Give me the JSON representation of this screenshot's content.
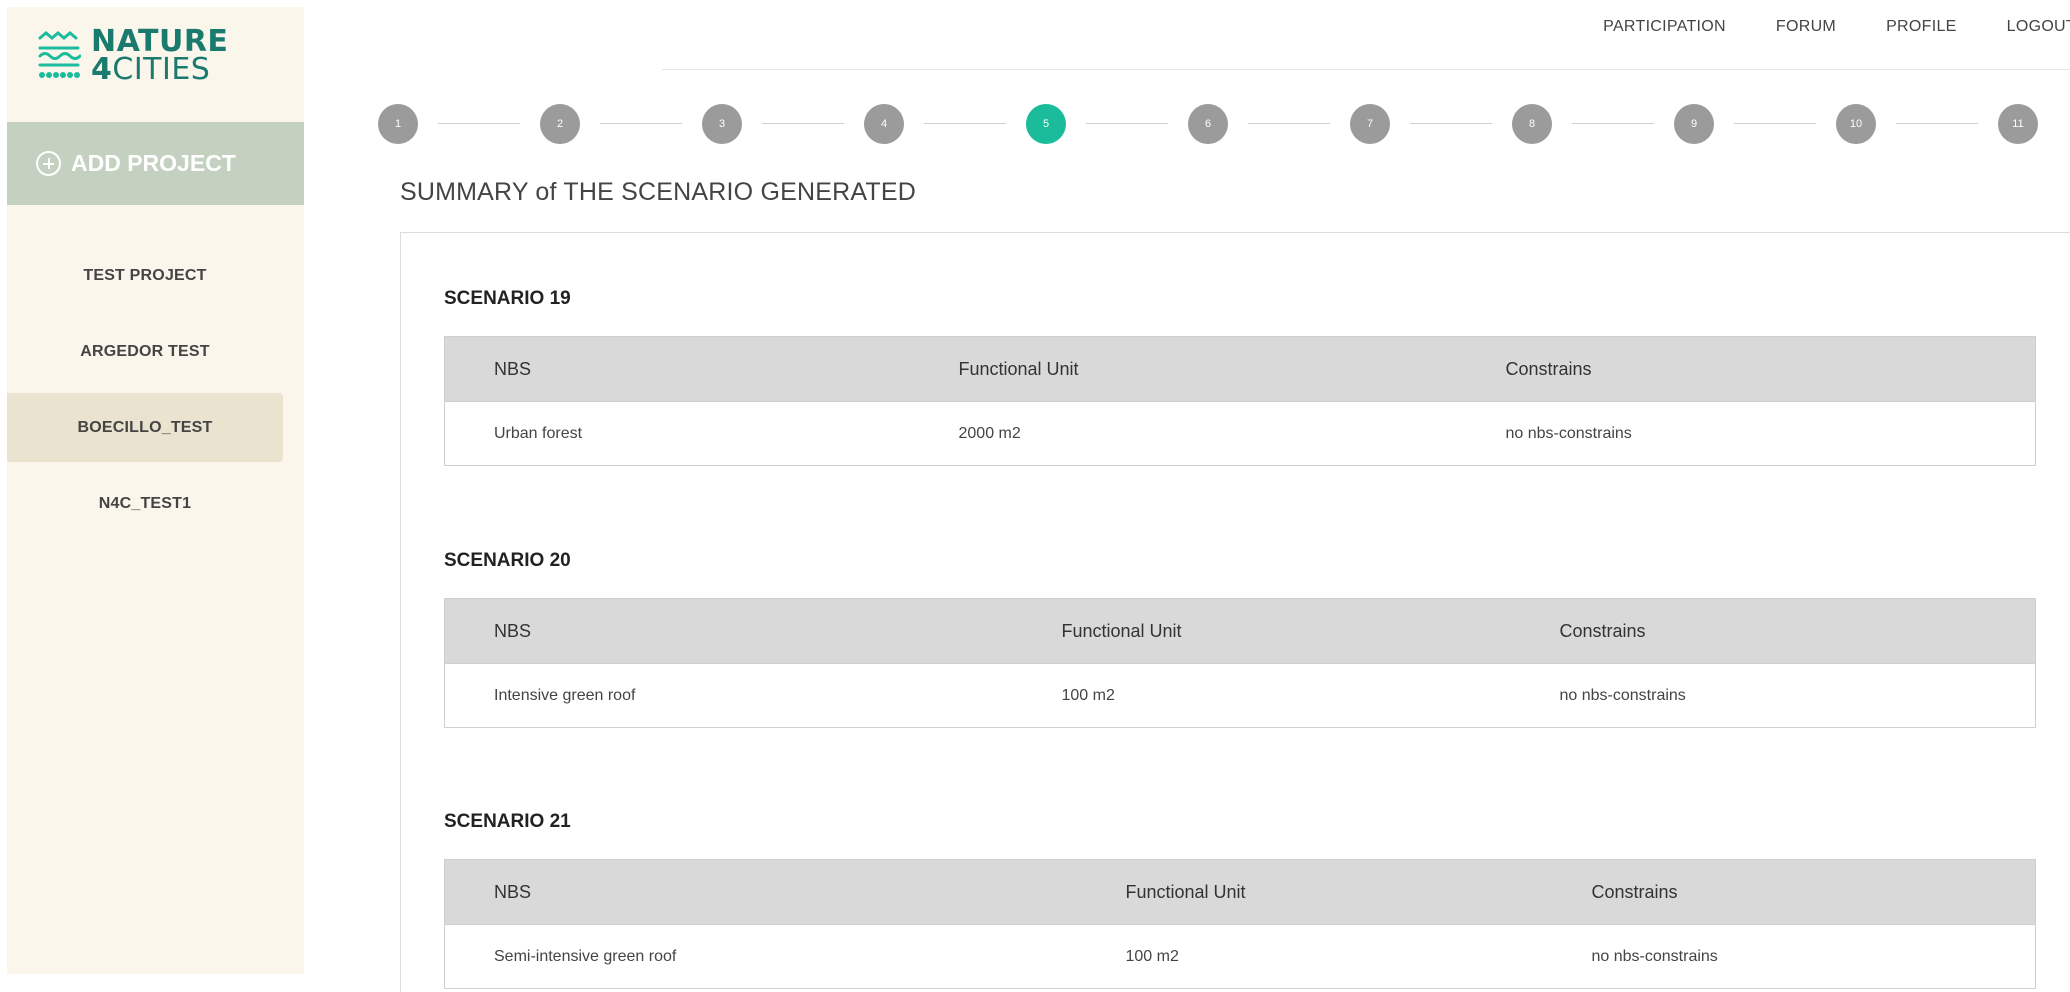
{
  "brand": {
    "line1": "NATURE",
    "line2_num": "4",
    "line2_text": "CITIES",
    "logo_icon": "waves-icon",
    "color": "#1a7a6d"
  },
  "sidebar": {
    "add_project_label": "ADD PROJECT",
    "projects": [
      {
        "label": "TEST PROJECT",
        "active": false
      },
      {
        "label": "ARGEDOR TEST",
        "active": false
      },
      {
        "label": "BOECILLO_TEST",
        "active": true
      },
      {
        "label": "N4C_TEST1",
        "active": false
      }
    ]
  },
  "topnav": {
    "items": [
      "PARTICIPATION",
      "FORUM",
      "PROFILE",
      "LOGOUT"
    ]
  },
  "stepper": {
    "steps": [
      "1",
      "2",
      "3",
      "4",
      "5",
      "6",
      "7",
      "8",
      "9",
      "10",
      "11"
    ],
    "current": 5,
    "active_color": "#1abc9c",
    "inactive_color": "#9b9b9b"
  },
  "main": {
    "title": "SUMMARY of THE SCENARIO GENERATED",
    "scenarios": [
      {
        "title": "SCENARIO 19",
        "headers": [
          "NBS",
          "Functional Unit",
          "Constrains"
        ],
        "rows": [
          [
            "Urban forest",
            "2000 m2",
            "no nbs-constrains"
          ]
        ]
      },
      {
        "title": "SCENARIO 20",
        "headers": [
          "NBS",
          "Functional Unit",
          "Constrains"
        ],
        "rows": [
          [
            "Intensive green roof",
            "100 m2",
            "no nbs-constrains"
          ]
        ]
      },
      {
        "title": "SCENARIO 21",
        "headers": [
          "NBS",
          "Functional Unit",
          "Constrains"
        ],
        "rows": [
          [
            "Semi-intensive green roof",
            "100 m2",
            "no nbs-constrains"
          ]
        ]
      }
    ]
  }
}
